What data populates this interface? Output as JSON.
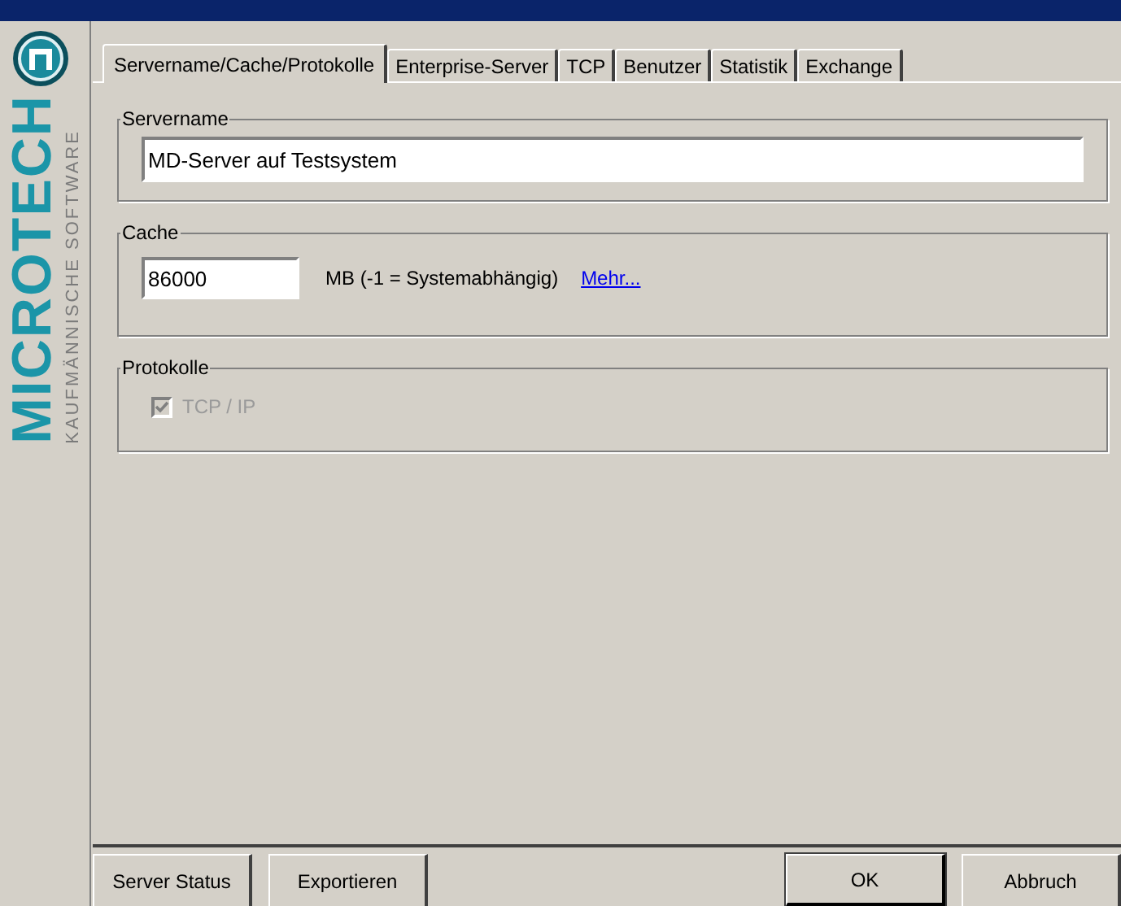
{
  "sidebar": {
    "brand": "MICROTECH",
    "tagline": "KAUFMÄNNISCHE SOFTWARE"
  },
  "tabs": [
    {
      "label": "Servername/Cache/Protokolle",
      "selected": true
    },
    {
      "label": "Enterprise-Server",
      "selected": false
    },
    {
      "label": "TCP",
      "selected": false
    },
    {
      "label": "Benutzer",
      "selected": false
    },
    {
      "label": "Statistik",
      "selected": false
    },
    {
      "label": "Exchange",
      "selected": false
    }
  ],
  "servername": {
    "legend": "Servername",
    "value": "MD-Server auf Testsystem"
  },
  "cache": {
    "legend": "Cache",
    "value": "86000",
    "unit": "MB (-1 = Systemabhängig)",
    "link": "Mehr..."
  },
  "protokolle": {
    "legend": "Protokolle",
    "options": [
      {
        "label": "TCP / IP",
        "checked": true,
        "disabled": true
      }
    ]
  },
  "buttons_left": [
    {
      "label": "Server Status",
      "default": false
    },
    {
      "label": "Exportieren",
      "default": false
    }
  ],
  "buttons_right": [
    {
      "label": "OK",
      "default": true
    },
    {
      "label": "Abbruch",
      "default": false
    }
  ]
}
